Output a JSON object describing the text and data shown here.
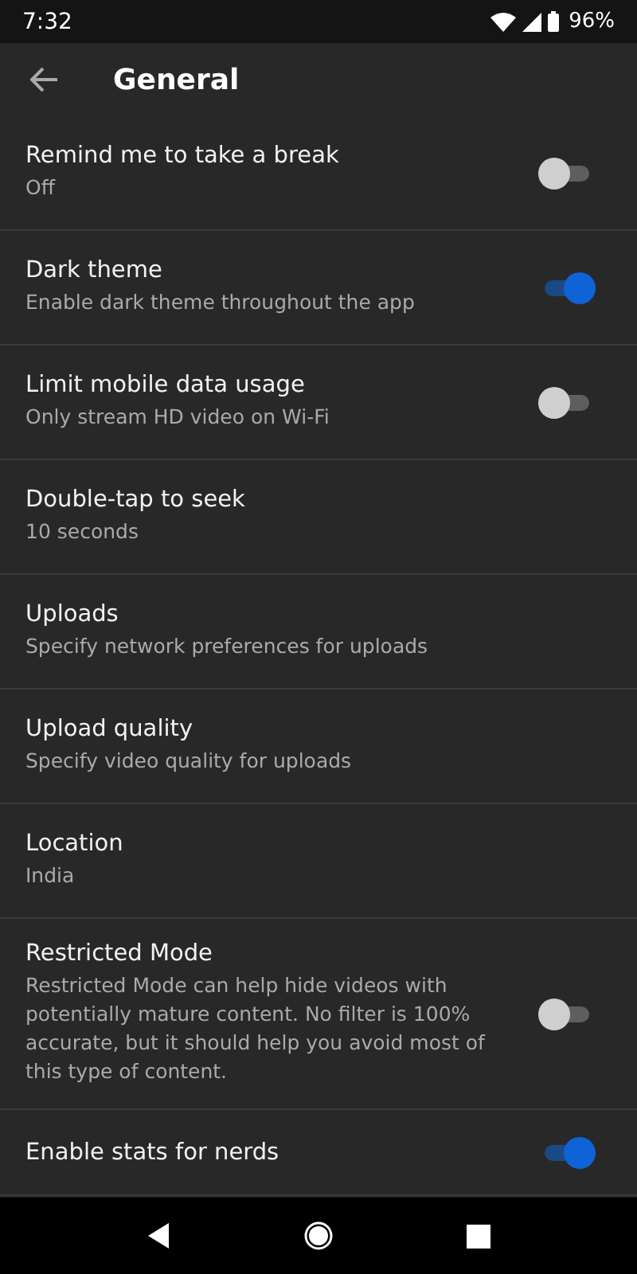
{
  "status_bar": {
    "time": "7:32",
    "battery": "96%"
  },
  "app_bar": {
    "title": "General"
  },
  "settings": [
    {
      "kind": "toggle",
      "title": "Remind me to take a break",
      "summary": "Off",
      "on": false
    },
    {
      "kind": "toggle",
      "title": "Dark theme",
      "summary": "Enable dark theme throughout the app",
      "on": true
    },
    {
      "kind": "toggle",
      "title": "Limit mobile data usage",
      "summary": "Only stream HD video on Wi-Fi",
      "on": false
    },
    {
      "kind": "plain",
      "title": "Double-tap to seek",
      "summary": "10 seconds"
    },
    {
      "kind": "plain",
      "title": "Uploads",
      "summary": "Specify network preferences for uploads"
    },
    {
      "kind": "plain",
      "title": "Upload quality",
      "summary": "Specify video quality for uploads"
    },
    {
      "kind": "plain",
      "title": "Location",
      "summary": "India"
    },
    {
      "kind": "toggle",
      "title": "Restricted Mode",
      "summary": "Restricted Mode can help hide videos with potentially mature content. No filter is 100% accurate, but it should help you avoid most of this type of content.",
      "on": false
    },
    {
      "kind": "toggle",
      "title": "Enable stats for nerds",
      "on": true
    }
  ]
}
